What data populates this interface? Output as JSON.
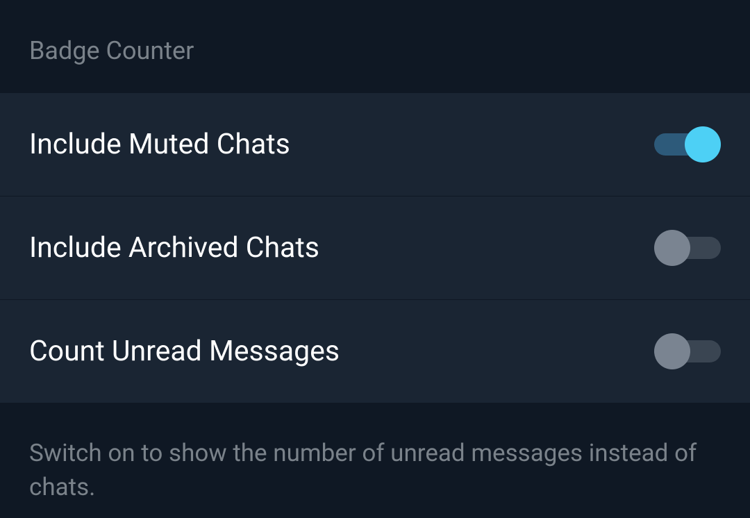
{
  "section": {
    "header": "Badge Counter",
    "footer": "Switch on to show the number of unread messages instead of chats."
  },
  "settings": [
    {
      "label": "Include Muted Chats",
      "enabled": true
    },
    {
      "label": "Include Archived Chats",
      "enabled": false
    },
    {
      "label": "Count Unread Messages",
      "enabled": false
    }
  ]
}
